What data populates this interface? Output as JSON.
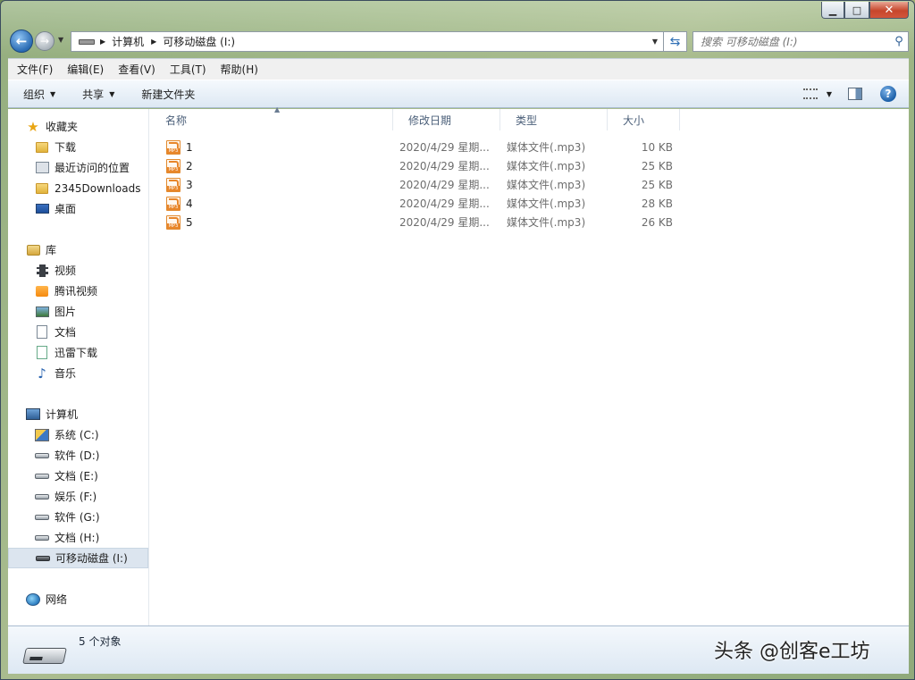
{
  "titlebar": {
    "minimize": "▁",
    "maximize": "□",
    "close": "✕"
  },
  "nav": {
    "address": [
      "计算机",
      "可移动磁盘 (I:)"
    ],
    "search_placeholder": "搜索 可移动磁盘 (I:)"
  },
  "menu": [
    "文件(F)",
    "编辑(E)",
    "查看(V)",
    "工具(T)",
    "帮助(H)"
  ],
  "commands": {
    "organize": "组织",
    "share": "共享",
    "new_folder": "新建文件夹"
  },
  "sidebar": {
    "favorites": {
      "label": "收藏夹",
      "items": [
        "下载",
        "最近访问的位置",
        "2345Downloads",
        "桌面"
      ]
    },
    "libraries": {
      "label": "库",
      "items": [
        "视频",
        "腾讯视频",
        "图片",
        "文档",
        "迅雷下载",
        "音乐"
      ]
    },
    "computer": {
      "label": "计算机",
      "items": [
        "系统 (C:)",
        "软件 (D:)",
        "文档 (E:)",
        "娱乐 (F:)",
        "软件 (G:)",
        "文档 (H:)",
        "可移动磁盘 (I:)"
      ]
    },
    "network": {
      "label": "网络"
    }
  },
  "columns": {
    "name": "名称",
    "date": "修改日期",
    "type": "类型",
    "size": "大小"
  },
  "files": [
    {
      "name": "1",
      "date": "2020/4/29 星期...",
      "type": "媒体文件(.mp3)",
      "size": "10 KB"
    },
    {
      "name": "2",
      "date": "2020/4/29 星期...",
      "type": "媒体文件(.mp3)",
      "size": "25 KB"
    },
    {
      "name": "3",
      "date": "2020/4/29 星期...",
      "type": "媒体文件(.mp3)",
      "size": "25 KB"
    },
    {
      "name": "4",
      "date": "2020/4/29 星期...",
      "type": "媒体文件(.mp3)",
      "size": "28 KB"
    },
    {
      "name": "5",
      "date": "2020/4/29 星期...",
      "type": "媒体文件(.mp3)",
      "size": "26 KB"
    }
  ],
  "details": {
    "count": "5 个对象"
  },
  "watermark": "头条 @创客e工坊",
  "colors": {
    "selection": "#dce5ef",
    "column_header": "#4c607a",
    "accent": "#2a6bb3"
  }
}
